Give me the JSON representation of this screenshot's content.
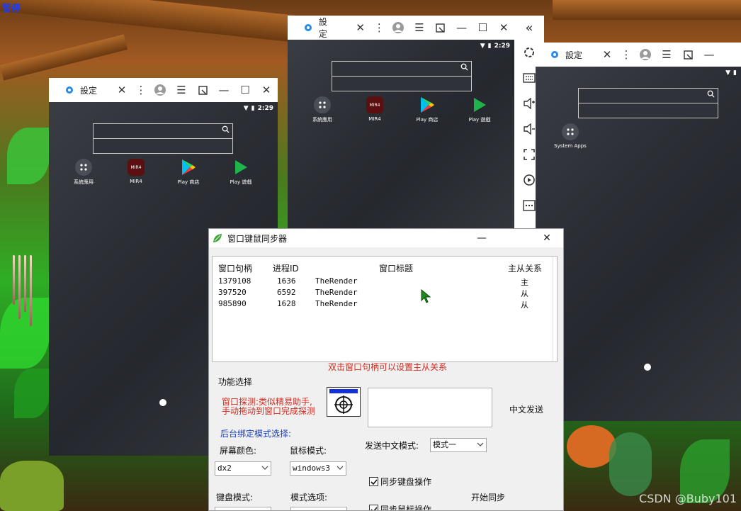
{
  "desktop": {
    "label": "暂停",
    "watermark": "CSDN @Buby101"
  },
  "emulators": [
    {
      "title": "設定",
      "time": "2:29",
      "apps": [
        "系統應用",
        "MIR4",
        "Play 商店",
        "Play 遊戲"
      ]
    },
    {
      "title": "設定",
      "time": "2:29",
      "apps": [
        "系統應用",
        "MIR4",
        "Play 商店",
        "Play 遊戲"
      ]
    },
    {
      "title": "設定",
      "time": "",
      "apps": [
        "System Apps"
      ]
    }
  ],
  "dialog": {
    "title": "窗口键鼠同步器",
    "columns": [
      "窗口句柄",
      "进程ID",
      "窗口标题",
      "主从关系"
    ],
    "rows": [
      {
        "handle": "1379108",
        "pid": "1636",
        "class": "TheRender",
        "role": "主"
      },
      {
        "handle": "397520",
        "pid": "6592",
        "class": "TheRender",
        "role": "从"
      },
      {
        "handle": "985890",
        "pid": "1628",
        "class": "TheRender",
        "role": "从"
      }
    ],
    "hint": "双击窗口句柄可以设置主从关系",
    "function_label": "功能选择",
    "probe_hint_line1": "窗口探测:类似精易助手,",
    "probe_hint_line2": "手动拖动到窗口完成探测",
    "chinese_send_label": "中文发送",
    "bind_mode_label": "后台绑定模式选择:",
    "screen_color_label": "屏幕颜色:",
    "screen_color_value": "dx2",
    "mouse_mode_label": "鼠标模式:",
    "mouse_mode_value": "windows3",
    "send_mode_label": "发送中文模式:",
    "send_mode_value": "模式一",
    "sync_keyboard_label": "同步键盘操作",
    "sync_mouse_label": "同步鼠标操作",
    "keyboard_mode_label": "键盘模式:",
    "mode_option_label": "模式选项:",
    "start_sync_label": "开始同步",
    "sync_keyboard_checked": true,
    "sync_mouse_checked": true
  }
}
